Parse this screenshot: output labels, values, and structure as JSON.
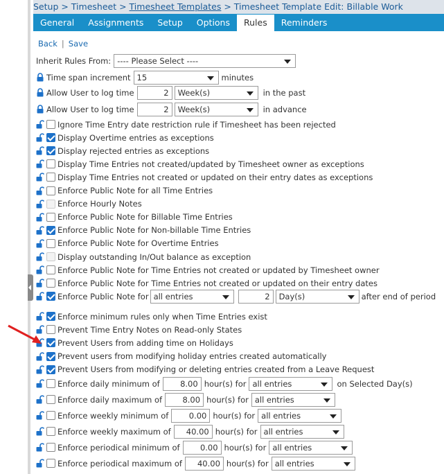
{
  "breadcrumb": {
    "p1": "Setup > Timesheet > ",
    "p2": "Timesheet Templates",
    "p3": " > Timesheet Template Edit: Billable Work"
  },
  "tabs": [
    "General",
    "Assignments",
    "Setup",
    "Options",
    "Rules",
    "Reminders"
  ],
  "actions": {
    "back": "Back",
    "sep": "|",
    "save": "Save"
  },
  "inherit": {
    "label": "Inherit Rules From:",
    "value": "---- Please Select ----"
  },
  "timespan": {
    "label": "Time span increment",
    "value": "15",
    "unit": "minutes"
  },
  "past": {
    "label": "Allow User to log time",
    "num": "2",
    "unit": "Week(s)",
    "suffix": "in the past"
  },
  "advance": {
    "label": "Allow User to log time",
    "num": "2",
    "unit": "Week(s)",
    "suffix": "in advance"
  },
  "rules": [
    {
      "label": "Ignore Time Entry date restriction rule if Timesheet has been rejected",
      "checked": false
    },
    {
      "label": "Display Overtime entries as exceptions",
      "checked": true
    },
    {
      "label": "Display rejected entries as exceptions",
      "checked": true
    },
    {
      "label": "Display Time Entries not created/updated by Timesheet owner as exceptions",
      "checked": false
    },
    {
      "label": "Display Time Entries not created or updated on their entry dates as exceptions",
      "checked": false
    },
    {
      "label": "Enforce Public Note for all Time Entries",
      "checked": false
    },
    {
      "label": "Enforce Hourly Notes",
      "checked": false,
      "disabled": true
    },
    {
      "label": "Enforce Public Note for Billable Time Entries",
      "checked": false
    },
    {
      "label": "Enforce Public Note for Non-billable Time Entries",
      "checked": true
    },
    {
      "label": "Enforce Public Note for Overtime Entries",
      "checked": false
    },
    {
      "label": "Display outstanding In/Out balance as exception",
      "checked": false,
      "disabled": true
    },
    {
      "label": "Enforce Public Note for Time Entries not created or updated by Timesheet owner",
      "checked": false
    },
    {
      "label": "Enforce Public Note for Time Entries not created or updated on their entry dates",
      "checked": false
    }
  ],
  "public_note_period": {
    "label": "Enforce Public Note for",
    "scope": "all entries",
    "num": "2",
    "unit": "Day(s)",
    "suffix": "after end of period",
    "checked": true
  },
  "rules2": [
    {
      "label": "Enforce minimum rules only when Time Entries exist",
      "checked": true
    },
    {
      "label": "Prevent Time Entry Notes on Read-only States",
      "checked": false
    },
    {
      "label": "Prevent Users from adding time on Holidays",
      "checked": true
    },
    {
      "label": "Prevent users from modifying holiday entries created automatically",
      "checked": true
    },
    {
      "label": "Prevent Users from modifying or deleting entries created from a Leave Request",
      "checked": true
    }
  ],
  "enforce": [
    {
      "label": "Enforce daily minimum of",
      "value": "8.00",
      "mid": "hour(s) for",
      "scope": "all entries",
      "suffix": "on Selected Day(s)"
    },
    {
      "label": "Enforce daily maximum of",
      "value": "8.00",
      "mid": "hour(s) for",
      "scope": "all entries",
      "suffix": ""
    },
    {
      "label": "Enforce weekly minimum of",
      "value": "0.00",
      "mid": "hour(s) for",
      "scope": "all entries",
      "suffix": ""
    },
    {
      "label": "Enforce weekly maximum of",
      "value": "40.00",
      "mid": "hour(s) for",
      "scope": "all entries",
      "suffix": ""
    },
    {
      "label": "Enforce periodical minimum of",
      "value": "0.00",
      "mid": "hour(s) for",
      "scope": "all entries",
      "suffix": ""
    },
    {
      "label": "Enforce periodical maximum of",
      "value": "40.00",
      "mid": "hour(s) for",
      "scope": "all entries",
      "suffix": ""
    }
  ],
  "colors": {
    "tab_bar": "#1a8fc9",
    "link": "#1a6ab0",
    "checkbox": "#1d71c9",
    "arrow": "#e02020"
  }
}
